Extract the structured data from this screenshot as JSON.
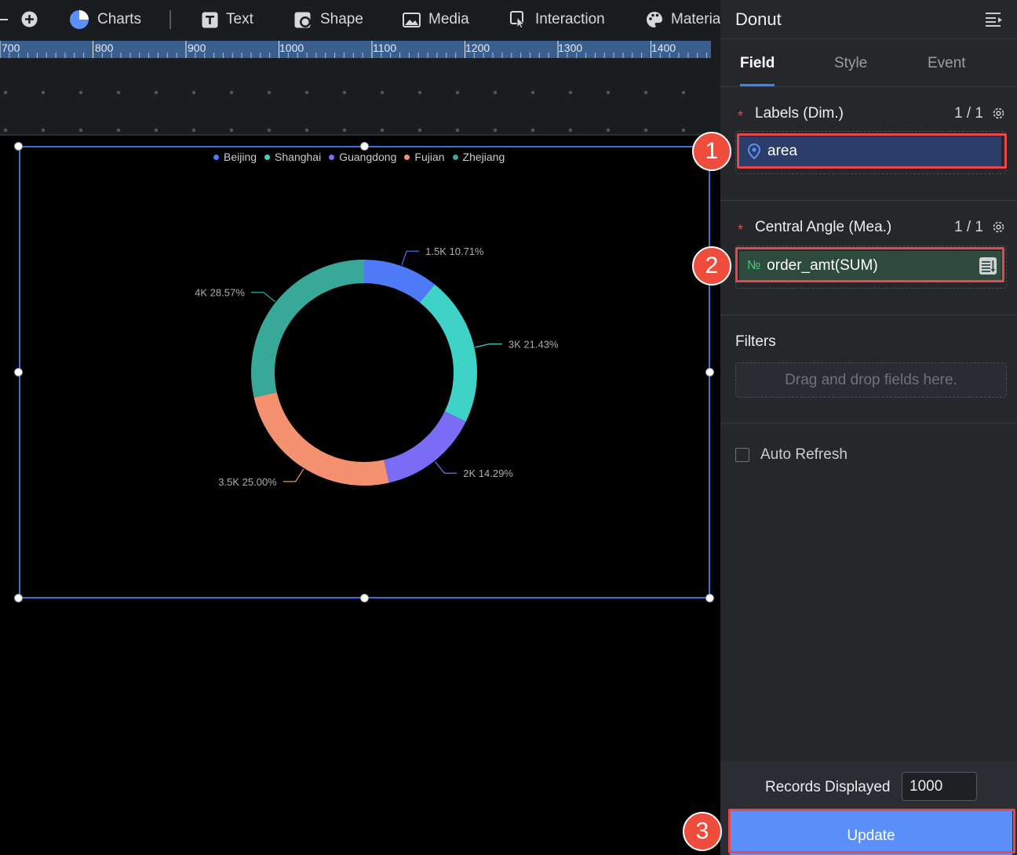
{
  "toolbar": {
    "items": [
      {
        "label": "Charts",
        "icon": "pie-chart-icon"
      },
      {
        "label": "Text",
        "icon": "text-icon"
      },
      {
        "label": "Shape",
        "icon": "shape-icon"
      },
      {
        "label": "Media",
        "icon": "image-icon"
      },
      {
        "label": "Interaction",
        "icon": "pointer-icon"
      },
      {
        "label": "Material",
        "icon": "palette-icon"
      }
    ]
  },
  "ruler": {
    "labels": [
      "700",
      "800",
      "900",
      "1000",
      "1100",
      "1200",
      "1300",
      "1400"
    ]
  },
  "chart_data": {
    "type": "donut",
    "categories": [
      "Beijing",
      "Shanghai",
      "Guangdong",
      "Fujian",
      "Zhejiang"
    ],
    "values": [
      1500,
      3000,
      2000,
      3500,
      4000
    ],
    "labels": [
      "1.5K 10.71%",
      "3K 21.43%",
      "2K 14.29%",
      "3.5K 25.00%",
      "4K 28.57%"
    ],
    "colors": [
      "#4e79f7",
      "#3fd3c8",
      "#7b6cf6",
      "#f4926f",
      "#38a899"
    ],
    "legend": "top"
  },
  "panel": {
    "title": "Donut",
    "tabs": [
      "Field",
      "Style",
      "Event"
    ],
    "labels_section": {
      "title": "Labels (Dim.)",
      "count": "1 / 1",
      "field": "area"
    },
    "angle_section": {
      "title": "Central Angle (Mea.)",
      "count": "1 / 1",
      "field": "order_amt(SUM)",
      "type_glyph": "№"
    },
    "filters": {
      "title": "Filters",
      "placeholder": "Drag and drop fields here."
    },
    "auto_refresh": "Auto Refresh",
    "records_label": "Records Displayed",
    "records_value": "1000",
    "update_label": "Update"
  },
  "badges": [
    "1",
    "2",
    "3"
  ]
}
